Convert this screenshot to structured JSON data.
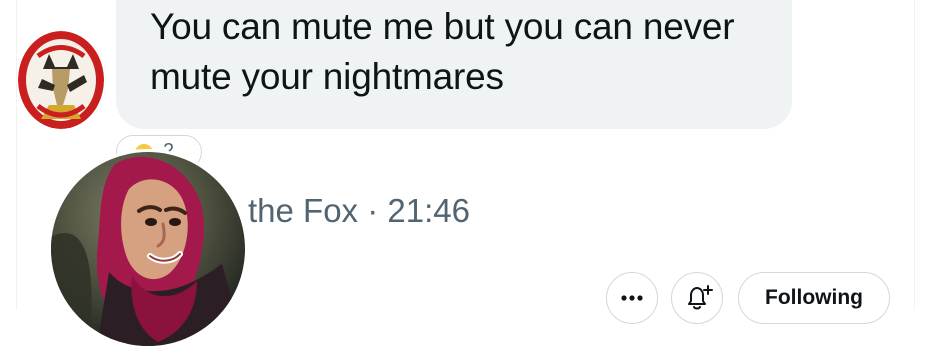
{
  "message": {
    "text": "You can mute me but you can never mute your nightmares"
  },
  "reaction": {
    "count": "2"
  },
  "profile": {
    "name_fragment": "the Fox",
    "separator": "·",
    "time": "21:46"
  },
  "actions": {
    "follow_label": "Following"
  },
  "icons": {
    "more": "more-horizontal-icon",
    "bell": "notification-bell-plus-icon"
  },
  "colors": {
    "bubble": "#eff3f4",
    "secondary_text": "#536471",
    "border": "#cfd9de"
  }
}
